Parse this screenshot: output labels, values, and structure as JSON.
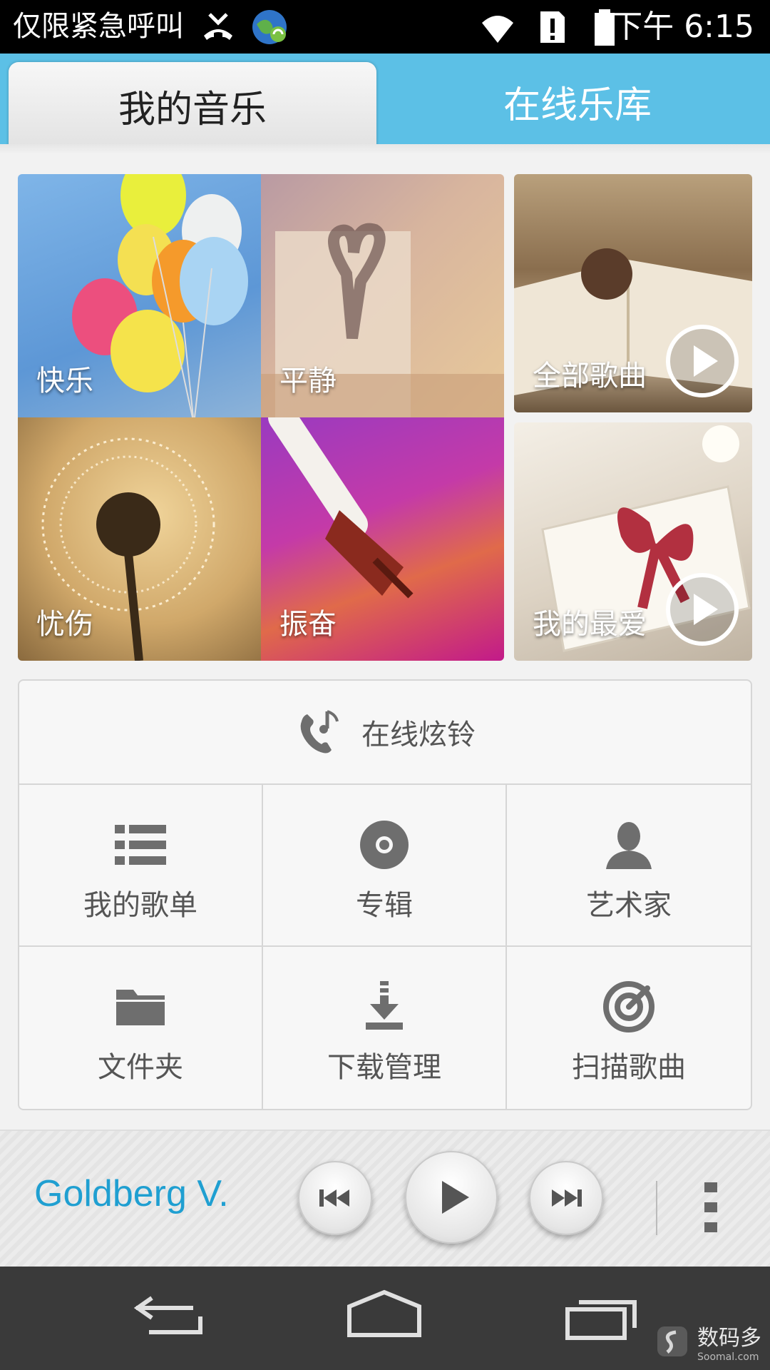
{
  "status_bar": {
    "carrier_text": "仅限紧急呼叫",
    "clock": "下午 6:15"
  },
  "tabs": [
    {
      "label": "我的音乐",
      "active": true
    },
    {
      "label": "在线乐库",
      "active": false
    }
  ],
  "moods": [
    {
      "label": "快乐"
    },
    {
      "label": "平静"
    },
    {
      "label": "忧伤"
    },
    {
      "label": "振奋"
    }
  ],
  "quick_play": [
    {
      "label": "全部歌曲"
    },
    {
      "label": "我的最爱"
    }
  ],
  "menu": {
    "ringtone_label": "在线炫铃",
    "items": [
      {
        "label": "我的歌单",
        "icon": "playlist-icon"
      },
      {
        "label": "专辑",
        "icon": "album-icon"
      },
      {
        "label": "艺术家",
        "icon": "artist-icon"
      },
      {
        "label": "文件夹",
        "icon": "folder-icon"
      },
      {
        "label": "下载管理",
        "icon": "download-icon"
      },
      {
        "label": "扫描歌曲",
        "icon": "scan-icon"
      }
    ]
  },
  "player": {
    "track_title": "Goldberg V."
  },
  "watermark": {
    "text": "数码多",
    "sub": "Soomal.com"
  },
  "colors": {
    "accent": "#5cc0e6",
    "track_title": "#1f9fd1",
    "navbar": "#3a3a3a"
  }
}
